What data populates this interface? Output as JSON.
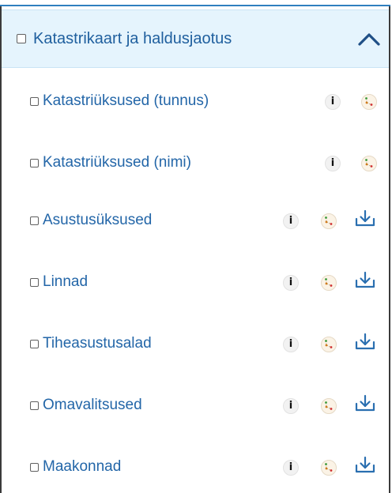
{
  "section": {
    "title": "Katastrikaart ja haldusjaotus",
    "expanded": true
  },
  "layers": [
    {
      "label": "Katastriüksused (tunnus)",
      "info": "i",
      "download": false
    },
    {
      "label": "Katastriüksused (nimi)",
      "info": "i",
      "download": false
    },
    {
      "label": "Asustusüksused",
      "info": "i",
      "download": true
    },
    {
      "label": "Linnad",
      "info": "i",
      "download": true
    },
    {
      "label": "Tiheasustusalad",
      "info": "i",
      "download": true
    },
    {
      "label": "Omavalitsused",
      "info": "i",
      "download": true
    },
    {
      "label": "Maakonnad",
      "info": "i",
      "download": true
    }
  ],
  "colors": {
    "accent": "#1f5f9e",
    "header_bg": "#e5f4fd",
    "link": "#2366a8"
  }
}
